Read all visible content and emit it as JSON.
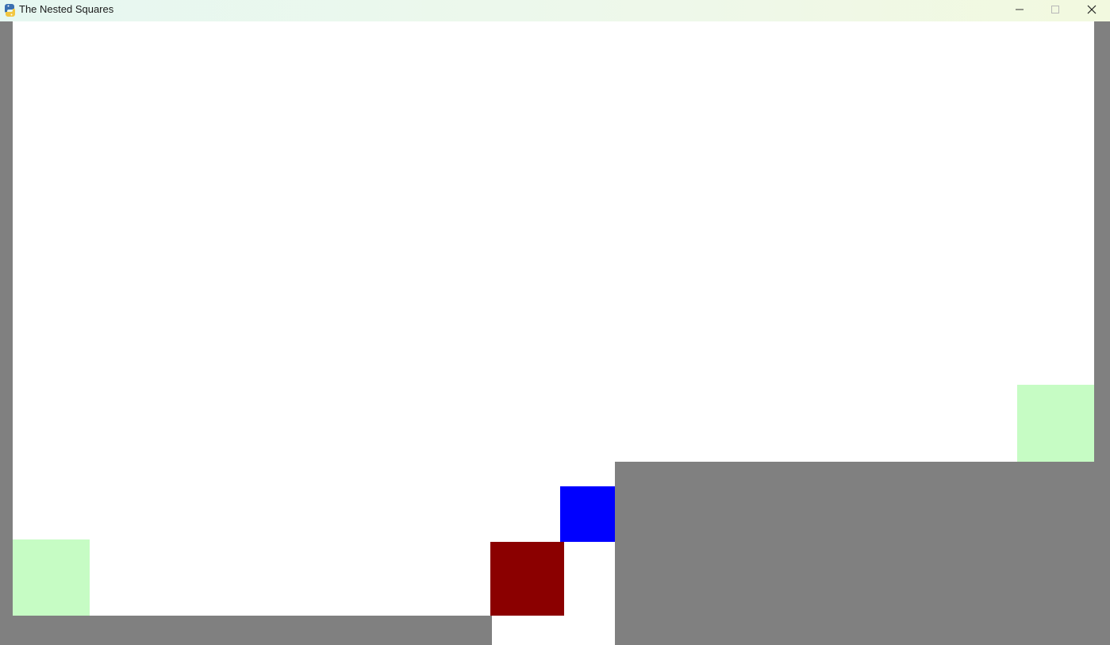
{
  "window": {
    "title": "The Nested Squares",
    "app_icon": "python-snake-icon",
    "controls": {
      "minimize_icon": "minimize-icon",
      "maximize_icon": "maximize-icon",
      "close_icon": "close-icon"
    }
  },
  "game": {
    "colors": {
      "wall": "#808080",
      "open_space": "#ffffff",
      "goal_zone": "#c6fcc4",
      "player_small": "#0000ff",
      "player_large": "#8b0000"
    }
  }
}
